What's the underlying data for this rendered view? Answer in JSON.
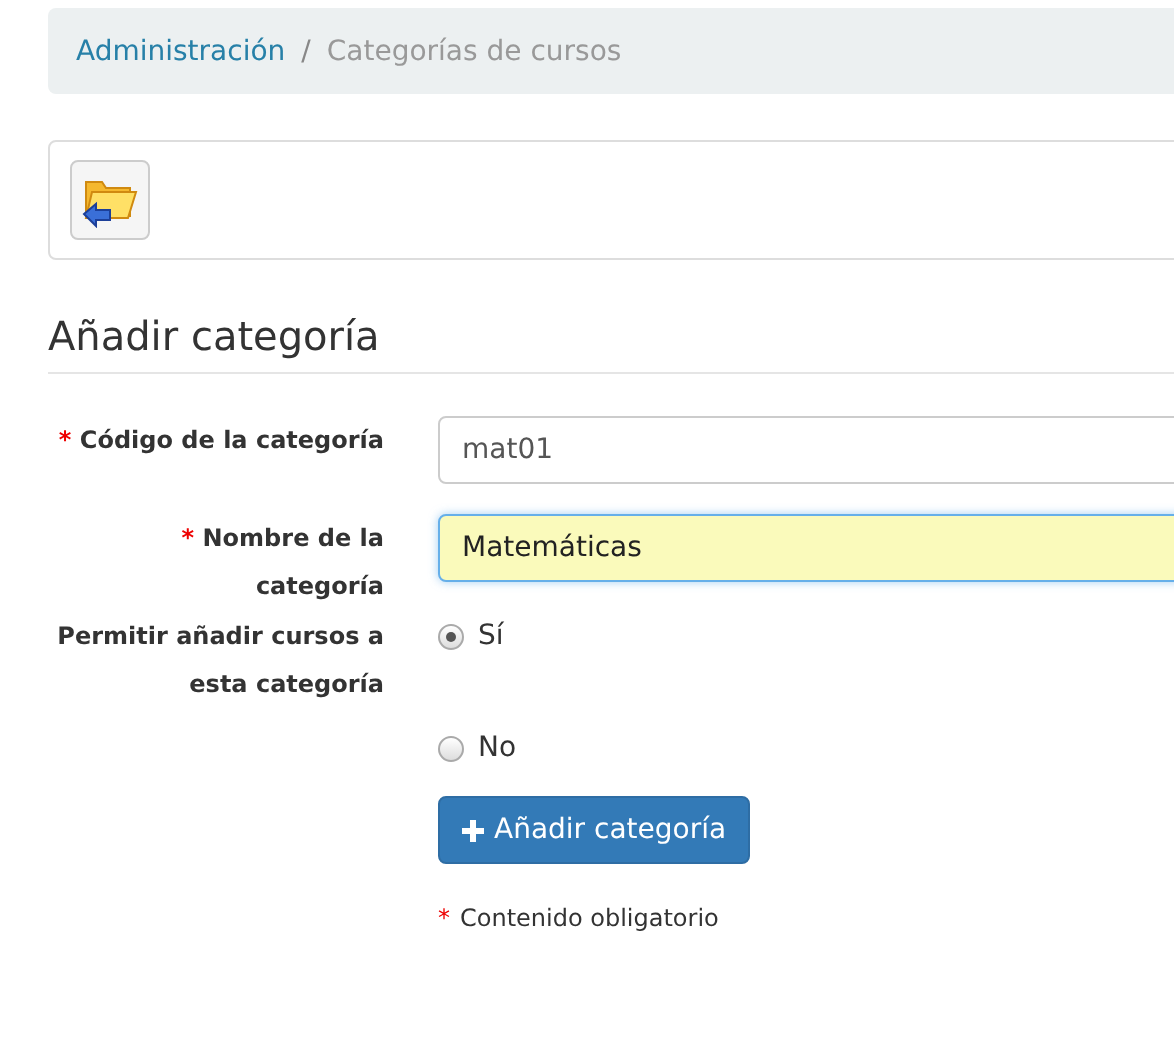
{
  "breadcrumb": [
    {
      "label": "Administración",
      "kind": "link"
    },
    {
      "label": "Categorías de cursos",
      "kind": "current"
    }
  ],
  "breadcrumb_separator": "/",
  "toolbar": {
    "buttons": [
      {
        "kind": "back-folder"
      }
    ]
  },
  "heading": "Añadir categoría",
  "fields": [
    {
      "label": "Código de la categoría",
      "mark": "*",
      "value": "mat01",
      "focused": false
    },
    {
      "label": "Nombre de la categoría",
      "mark": "*",
      "value": "Matemáticas",
      "focused": true
    }
  ],
  "option_group": {
    "label": "Permitir añadir cursos a esta categoría",
    "options": [
      {
        "label": "Sí",
        "selected": true
      },
      {
        "label": "No",
        "selected": false
      }
    ]
  },
  "submit": {
    "label": "Añadir categoría"
  },
  "note": {
    "mark": "*",
    "text": "Contenido obligatorio"
  }
}
